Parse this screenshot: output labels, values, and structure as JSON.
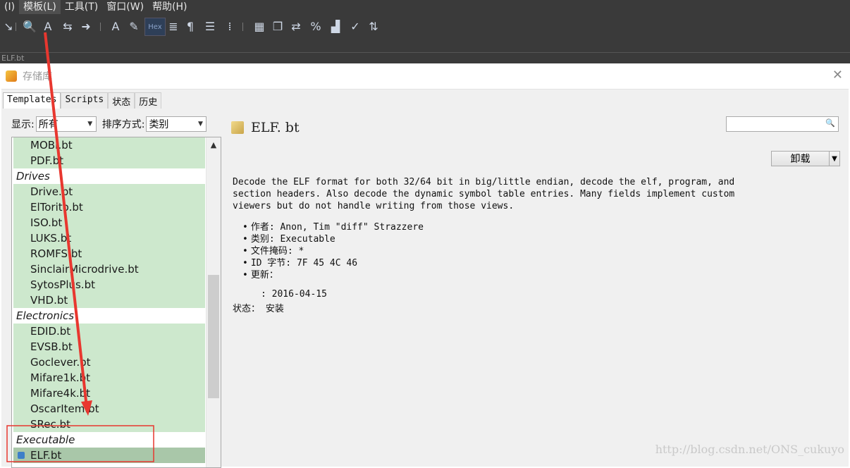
{
  "menubar": {
    "items": [
      {
        "label": "(I)"
      },
      {
        "label": "模板(L)"
      },
      {
        "label": "工具(T)"
      },
      {
        "label": "窗口(W)"
      },
      {
        "label": "帮助(H)"
      }
    ]
  },
  "toolbar": {
    "hex_label": "Hex"
  },
  "doc_tab": {
    "label": "ELF.bt"
  },
  "dialog": {
    "title": "存储库",
    "tabs": [
      {
        "label": "Templates"
      },
      {
        "label": "Scripts"
      },
      {
        "label": "状态"
      },
      {
        "label": "历史"
      }
    ],
    "filter": {
      "show_label": "显示:",
      "show_value": "所有",
      "sort_label": "排序方式:",
      "sort_value": "类别"
    },
    "search": {
      "placeholder": ""
    },
    "list": [
      {
        "label": "MOBI.bt",
        "kind": "item"
      },
      {
        "label": "PDF.bt",
        "kind": "item"
      },
      {
        "label": "Drives",
        "kind": "category"
      },
      {
        "label": "Drive.bt",
        "kind": "item"
      },
      {
        "label": "ElTorito.bt",
        "kind": "item"
      },
      {
        "label": "ISO.bt",
        "kind": "item"
      },
      {
        "label": "LUKS.bt",
        "kind": "item"
      },
      {
        "label": "ROMFS.bt",
        "kind": "item"
      },
      {
        "label": "SinclairMicrodrive.bt",
        "kind": "item"
      },
      {
        "label": "SytosPlus.bt",
        "kind": "item"
      },
      {
        "label": "VHD.bt",
        "kind": "item"
      },
      {
        "label": "Electronics",
        "kind": "category"
      },
      {
        "label": "EDID.bt",
        "kind": "item"
      },
      {
        "label": "EVSB.bt",
        "kind": "item"
      },
      {
        "label": "Goclever.bt",
        "kind": "item"
      },
      {
        "label": "Mifare1k.bt",
        "kind": "item"
      },
      {
        "label": "Mifare4k.bt",
        "kind": "item"
      },
      {
        "label": "OscarItem.bt",
        "kind": "item"
      },
      {
        "label": "SRec.bt",
        "kind": "item"
      },
      {
        "label": "Executable",
        "kind": "category"
      },
      {
        "label": "ELF.bt",
        "kind": "selected"
      }
    ],
    "detail": {
      "name": "ELF. bt",
      "uninstall_label": "卸载",
      "description": "Decode the ELF format for both 32/64 bit in big/little endian, decode the elf, program, and section headers. Also decode the dynamic symbol table entries. Many fields implement custom viewers but do not handle writing from those views.",
      "bullets": [
        "作者: Anon, Tim \"diff\" Strazzere",
        "类别: Executable",
        "文件掩码: *",
        "ID 字节: 7F 45 4C 46",
        "更新："
      ],
      "date": ": 2016-04-15",
      "status": "状态： 安装"
    }
  },
  "watermark": "http://blog.csdn.net/ONS_cukuyo",
  "annotation_color": "#e8372f"
}
